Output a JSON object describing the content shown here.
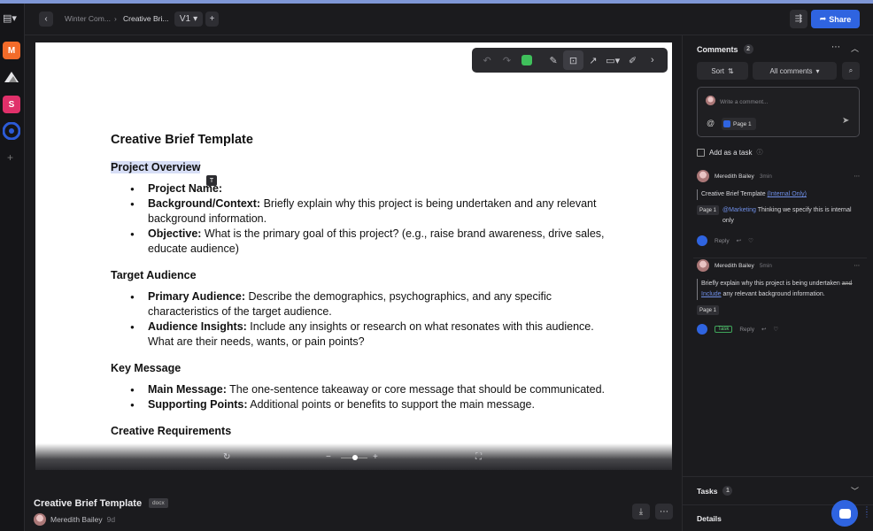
{
  "rail": {
    "workspaces": [
      {
        "letter": "M",
        "color": "#f26b2a"
      },
      {
        "letter": "",
        "color": "#2a2a2e"
      },
      {
        "letter": "S",
        "color": "#e0306a"
      },
      {
        "letter": "",
        "color": "#2c5bd8"
      }
    ],
    "add": "+"
  },
  "header": {
    "breadcrumbs": [
      "Winter Com...",
      "Creative Bri..."
    ],
    "version": "V1",
    "share_label": "Share"
  },
  "toolbar": {
    "icons": [
      "undo-icon",
      "redo-icon",
      "color-swatch-icon",
      "pin-icon",
      "focus-icon",
      "arrow-icon",
      "rectangle-icon",
      "pen-icon",
      "chevron-right-icon"
    ]
  },
  "document": {
    "title": "Creative Brief Template",
    "sections": [
      {
        "heading": "Project Overview",
        "items": [
          {
            "label": "Project Name:",
            "text": ""
          },
          {
            "label": "Background/Context:",
            "text": " Briefly explain why this project is being undertaken and any relevant background information."
          },
          {
            "label": "Objective:",
            "text": " What is the primary goal of this project? (e.g., raise brand awareness, drive sales, educate audience)"
          }
        ]
      },
      {
        "heading": "Target Audience",
        "items": [
          {
            "label": "Primary Audience:",
            "text": " Describe the demographics, psychographics, and any specific characteristics of the target audience."
          },
          {
            "label": "Audience Insights:",
            "text": " Include any insights or research on what resonates with this audience. What are their needs, wants, or pain points?"
          }
        ]
      },
      {
        "heading": "Key Message",
        "items": [
          {
            "label": "Main Message:",
            "text": " The one-sentence takeaway or core message that should be communicated."
          },
          {
            "label": "Supporting Points:",
            "text": " Additional points or benefits to support the main message."
          }
        ]
      }
    ],
    "next_heading_partial": "Creative Requirements"
  },
  "file": {
    "name": "Creative Brief Template",
    "ext": "docx",
    "owner": "Meredith Bailey",
    "ago": "9d"
  },
  "panel": {
    "title": "Comments",
    "count": "2",
    "sort_label": "Sort",
    "filter_label": "All comments",
    "composer_placeholder": "Write a comment...",
    "at": "@",
    "page_chip": "Page 1",
    "add_task_label": "Add as a task",
    "comments": [
      {
        "author": "Meredith Bailey",
        "time": "3min",
        "quote_text": "Creative Brief Template ",
        "quote_link": "(Internal Only)",
        "page": "Page 1",
        "mention": "@Marketing",
        "body": " Thinking we specify this is internal only",
        "reply": "Reply"
      },
      {
        "author": "Meredith Bailey",
        "time": "5min",
        "quote_a": "Briefly explain why this project is being undertaken ",
        "quote_strike": "and",
        "quote_link": " Include",
        "quote_b": " any relevant background information.",
        "page": "Page 1",
        "task": "Task",
        "reply": "Reply"
      }
    ],
    "tasks_label": "Tasks",
    "tasks_count": "1",
    "details_label": "Details"
  }
}
